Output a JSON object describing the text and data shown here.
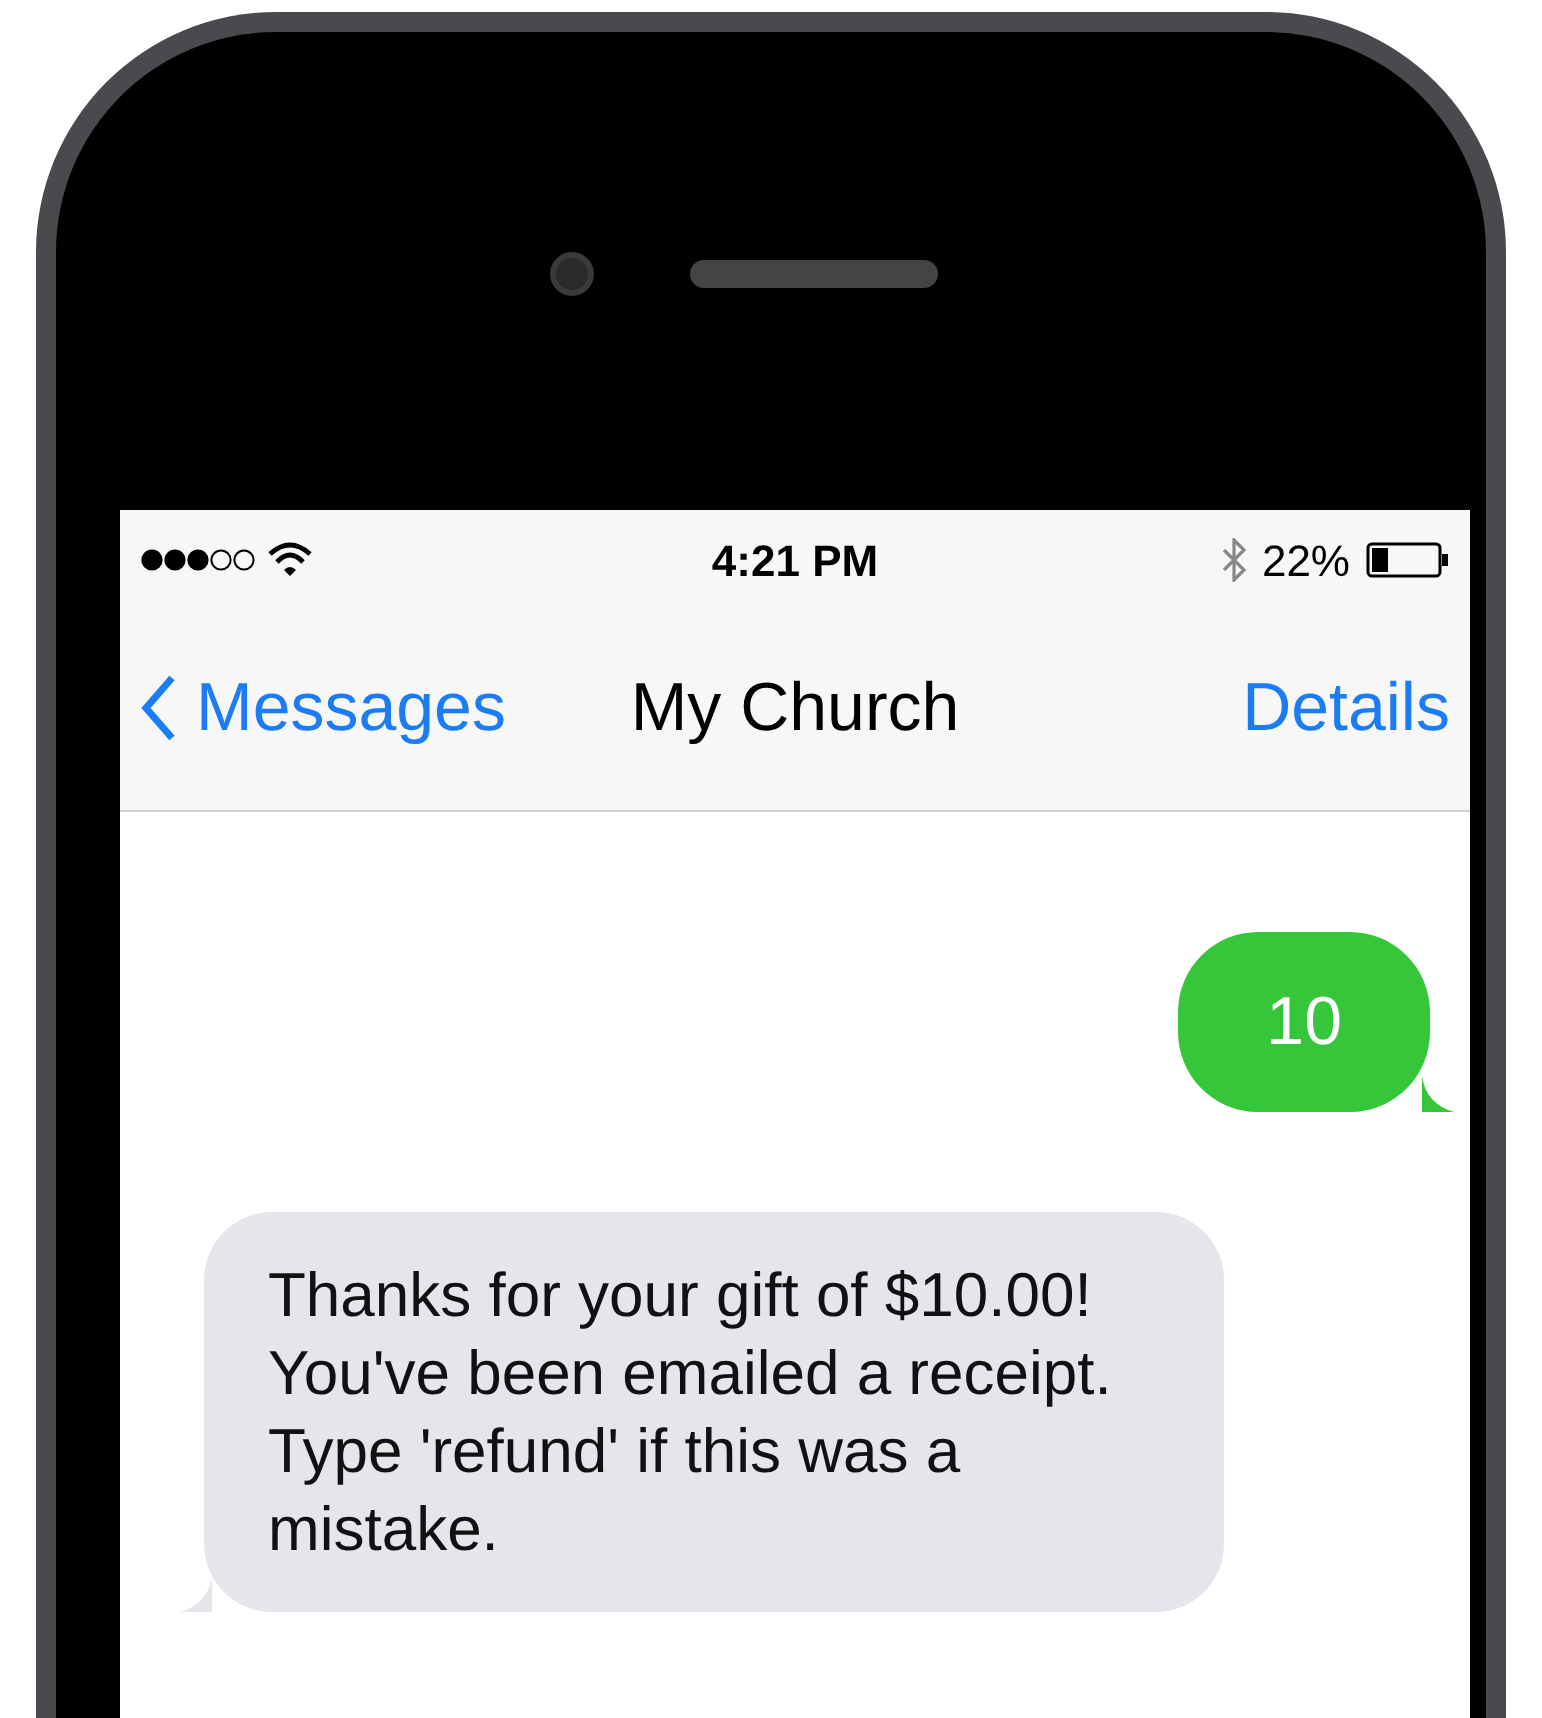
{
  "status_bar": {
    "time": "4:21 PM",
    "battery": "22%"
  },
  "nav_bar": {
    "back": "Messages",
    "title": "My Church",
    "action": "Details"
  },
  "messages": [
    {
      "kind": "sent",
      "text": "10"
    },
    {
      "kind": "received",
      "text": "Thanks for your gift of $10.00! You've been emailed a receipt. Type 'refund' if this was a mistake."
    }
  ]
}
